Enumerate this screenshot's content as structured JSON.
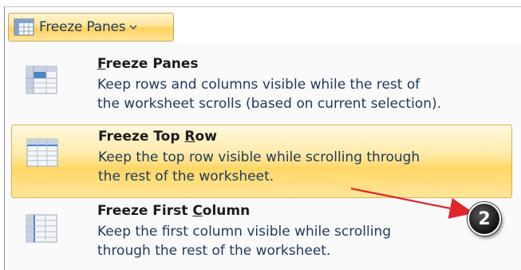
{
  "ribbon_button": {
    "label": "Freeze Panes",
    "icon": "freeze-panes-icon",
    "dropdown_icon": "chevron-down-icon"
  },
  "menu": {
    "items": [
      {
        "title_pre": "",
        "title_ul": "F",
        "title_post": "reeze Panes",
        "desc_line1": "Keep rows and columns visible while the rest of",
        "desc_line2": "the worksheet scrolls (based on current selection).",
        "icon": "freeze-panes-icon",
        "highlighted": false
      },
      {
        "title_pre": "Freeze Top ",
        "title_ul": "R",
        "title_post": "ow",
        "desc_line1": "Keep the top row visible while scrolling through",
        "desc_line2": "the rest of the worksheet.",
        "icon": "freeze-top-row-icon",
        "highlighted": true
      },
      {
        "title_pre": "Freeze First ",
        "title_ul": "C",
        "title_post": "olumn",
        "desc_line1": "Keep the first column visible while scrolling",
        "desc_line2": "through the rest of the worksheet.",
        "icon": "freeze-first-column-icon",
        "highlighted": false
      }
    ]
  },
  "annotation": {
    "callout_number": "2",
    "arrow_color": "#e0262b"
  },
  "colors": {
    "highlight": "#ffd766",
    "text_blue": "#1e395b"
  }
}
